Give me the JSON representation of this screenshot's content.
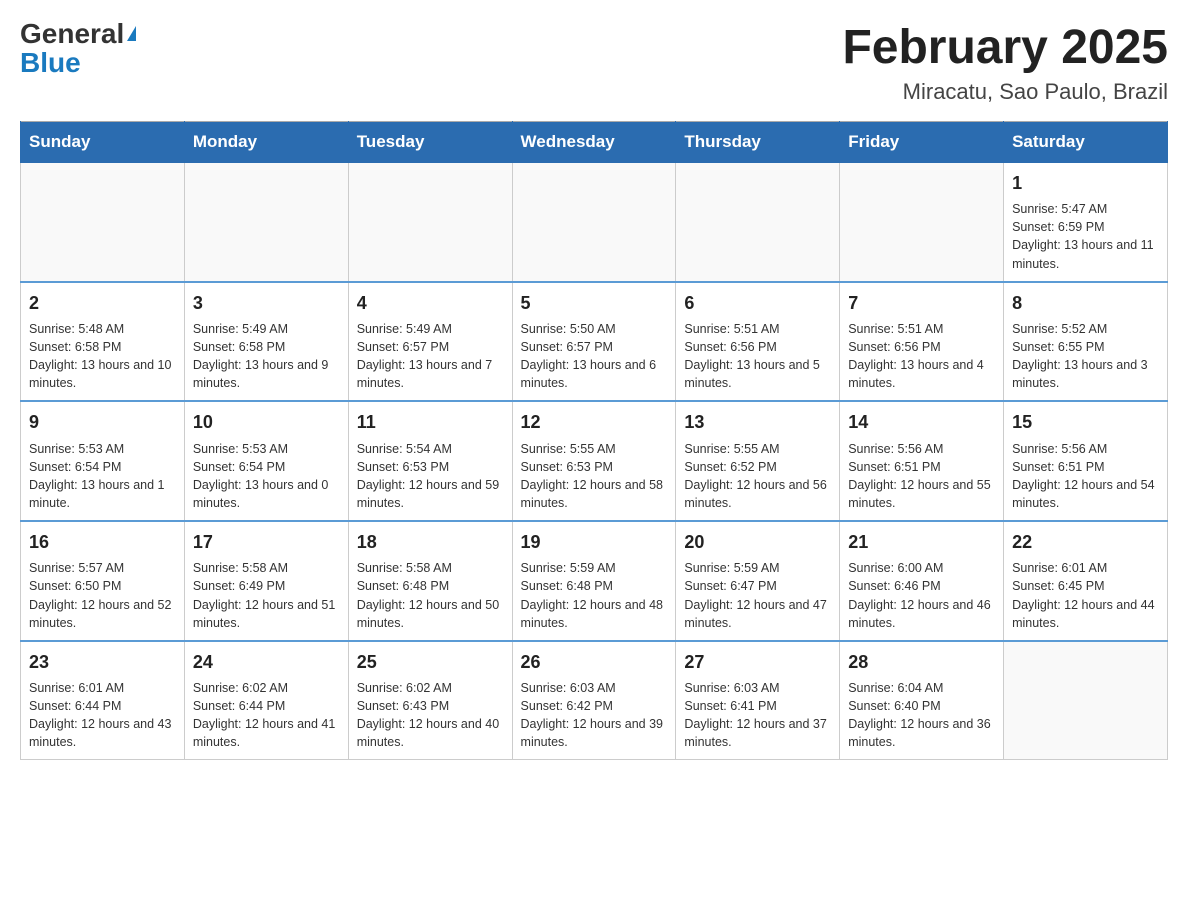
{
  "header": {
    "logo_general": "General",
    "logo_blue": "Blue",
    "month_title": "February 2025",
    "location": "Miracatu, Sao Paulo, Brazil"
  },
  "weekdays": [
    "Sunday",
    "Monday",
    "Tuesday",
    "Wednesday",
    "Thursday",
    "Friday",
    "Saturday"
  ],
  "weeks": [
    [
      {
        "day": "",
        "sunrise": "",
        "sunset": "",
        "daylight": "",
        "empty": true
      },
      {
        "day": "",
        "sunrise": "",
        "sunset": "",
        "daylight": "",
        "empty": true
      },
      {
        "day": "",
        "sunrise": "",
        "sunset": "",
        "daylight": "",
        "empty": true
      },
      {
        "day": "",
        "sunrise": "",
        "sunset": "",
        "daylight": "",
        "empty": true
      },
      {
        "day": "",
        "sunrise": "",
        "sunset": "",
        "daylight": "",
        "empty": true
      },
      {
        "day": "",
        "sunrise": "",
        "sunset": "",
        "daylight": "",
        "empty": true
      },
      {
        "day": "1",
        "sunrise": "Sunrise: 5:47 AM",
        "sunset": "Sunset: 6:59 PM",
        "daylight": "Daylight: 13 hours and 11 minutes.",
        "empty": false
      }
    ],
    [
      {
        "day": "2",
        "sunrise": "Sunrise: 5:48 AM",
        "sunset": "Sunset: 6:58 PM",
        "daylight": "Daylight: 13 hours and 10 minutes.",
        "empty": false
      },
      {
        "day": "3",
        "sunrise": "Sunrise: 5:49 AM",
        "sunset": "Sunset: 6:58 PM",
        "daylight": "Daylight: 13 hours and 9 minutes.",
        "empty": false
      },
      {
        "day": "4",
        "sunrise": "Sunrise: 5:49 AM",
        "sunset": "Sunset: 6:57 PM",
        "daylight": "Daylight: 13 hours and 7 minutes.",
        "empty": false
      },
      {
        "day": "5",
        "sunrise": "Sunrise: 5:50 AM",
        "sunset": "Sunset: 6:57 PM",
        "daylight": "Daylight: 13 hours and 6 minutes.",
        "empty": false
      },
      {
        "day": "6",
        "sunrise": "Sunrise: 5:51 AM",
        "sunset": "Sunset: 6:56 PM",
        "daylight": "Daylight: 13 hours and 5 minutes.",
        "empty": false
      },
      {
        "day": "7",
        "sunrise": "Sunrise: 5:51 AM",
        "sunset": "Sunset: 6:56 PM",
        "daylight": "Daylight: 13 hours and 4 minutes.",
        "empty": false
      },
      {
        "day": "8",
        "sunrise": "Sunrise: 5:52 AM",
        "sunset": "Sunset: 6:55 PM",
        "daylight": "Daylight: 13 hours and 3 minutes.",
        "empty": false
      }
    ],
    [
      {
        "day": "9",
        "sunrise": "Sunrise: 5:53 AM",
        "sunset": "Sunset: 6:54 PM",
        "daylight": "Daylight: 13 hours and 1 minute.",
        "empty": false
      },
      {
        "day": "10",
        "sunrise": "Sunrise: 5:53 AM",
        "sunset": "Sunset: 6:54 PM",
        "daylight": "Daylight: 13 hours and 0 minutes.",
        "empty": false
      },
      {
        "day": "11",
        "sunrise": "Sunrise: 5:54 AM",
        "sunset": "Sunset: 6:53 PM",
        "daylight": "Daylight: 12 hours and 59 minutes.",
        "empty": false
      },
      {
        "day": "12",
        "sunrise": "Sunrise: 5:55 AM",
        "sunset": "Sunset: 6:53 PM",
        "daylight": "Daylight: 12 hours and 58 minutes.",
        "empty": false
      },
      {
        "day": "13",
        "sunrise": "Sunrise: 5:55 AM",
        "sunset": "Sunset: 6:52 PM",
        "daylight": "Daylight: 12 hours and 56 minutes.",
        "empty": false
      },
      {
        "day": "14",
        "sunrise": "Sunrise: 5:56 AM",
        "sunset": "Sunset: 6:51 PM",
        "daylight": "Daylight: 12 hours and 55 minutes.",
        "empty": false
      },
      {
        "day": "15",
        "sunrise": "Sunrise: 5:56 AM",
        "sunset": "Sunset: 6:51 PM",
        "daylight": "Daylight: 12 hours and 54 minutes.",
        "empty": false
      }
    ],
    [
      {
        "day": "16",
        "sunrise": "Sunrise: 5:57 AM",
        "sunset": "Sunset: 6:50 PM",
        "daylight": "Daylight: 12 hours and 52 minutes.",
        "empty": false
      },
      {
        "day": "17",
        "sunrise": "Sunrise: 5:58 AM",
        "sunset": "Sunset: 6:49 PM",
        "daylight": "Daylight: 12 hours and 51 minutes.",
        "empty": false
      },
      {
        "day": "18",
        "sunrise": "Sunrise: 5:58 AM",
        "sunset": "Sunset: 6:48 PM",
        "daylight": "Daylight: 12 hours and 50 minutes.",
        "empty": false
      },
      {
        "day": "19",
        "sunrise": "Sunrise: 5:59 AM",
        "sunset": "Sunset: 6:48 PM",
        "daylight": "Daylight: 12 hours and 48 minutes.",
        "empty": false
      },
      {
        "day": "20",
        "sunrise": "Sunrise: 5:59 AM",
        "sunset": "Sunset: 6:47 PM",
        "daylight": "Daylight: 12 hours and 47 minutes.",
        "empty": false
      },
      {
        "day": "21",
        "sunrise": "Sunrise: 6:00 AM",
        "sunset": "Sunset: 6:46 PM",
        "daylight": "Daylight: 12 hours and 46 minutes.",
        "empty": false
      },
      {
        "day": "22",
        "sunrise": "Sunrise: 6:01 AM",
        "sunset": "Sunset: 6:45 PM",
        "daylight": "Daylight: 12 hours and 44 minutes.",
        "empty": false
      }
    ],
    [
      {
        "day": "23",
        "sunrise": "Sunrise: 6:01 AM",
        "sunset": "Sunset: 6:44 PM",
        "daylight": "Daylight: 12 hours and 43 minutes.",
        "empty": false
      },
      {
        "day": "24",
        "sunrise": "Sunrise: 6:02 AM",
        "sunset": "Sunset: 6:44 PM",
        "daylight": "Daylight: 12 hours and 41 minutes.",
        "empty": false
      },
      {
        "day": "25",
        "sunrise": "Sunrise: 6:02 AM",
        "sunset": "Sunset: 6:43 PM",
        "daylight": "Daylight: 12 hours and 40 minutes.",
        "empty": false
      },
      {
        "day": "26",
        "sunrise": "Sunrise: 6:03 AM",
        "sunset": "Sunset: 6:42 PM",
        "daylight": "Daylight: 12 hours and 39 minutes.",
        "empty": false
      },
      {
        "day": "27",
        "sunrise": "Sunrise: 6:03 AM",
        "sunset": "Sunset: 6:41 PM",
        "daylight": "Daylight: 12 hours and 37 minutes.",
        "empty": false
      },
      {
        "day": "28",
        "sunrise": "Sunrise: 6:04 AM",
        "sunset": "Sunset: 6:40 PM",
        "daylight": "Daylight: 12 hours and 36 minutes.",
        "empty": false
      },
      {
        "day": "",
        "sunrise": "",
        "sunset": "",
        "daylight": "",
        "empty": true
      }
    ]
  ]
}
